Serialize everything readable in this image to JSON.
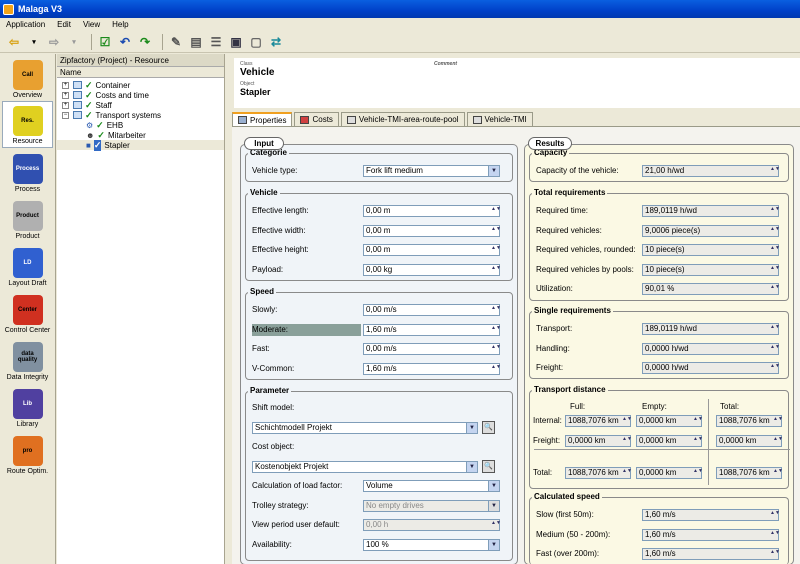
{
  "app": {
    "title": "Malaga V3"
  },
  "menu": [
    "Application",
    "Edit",
    "View",
    "Help"
  ],
  "nav": [
    {
      "label": "Overview",
      "icon": "overview-icon",
      "color": "#e8a030",
      "glyph": "Call"
    },
    {
      "label": "Resource",
      "icon": "resource-icon",
      "color": "#e0d020",
      "glyph": "Res."
    },
    {
      "label": "Process",
      "icon": "process-icon",
      "color": "#3050b0",
      "glyph": "Process"
    },
    {
      "label": "Product",
      "icon": "product-icon",
      "color": "#b0b0b0",
      "glyph": "Product"
    },
    {
      "label": "Layout Draft",
      "icon": "layout-draft-icon",
      "color": "#3060d0",
      "glyph": "LD"
    },
    {
      "label": "Control Center",
      "icon": "control-center-icon",
      "color": "#d03020",
      "glyph": "Center"
    },
    {
      "label": "Data Integrity",
      "icon": "data-integrity-icon",
      "color": "#8090a0",
      "glyph": "data quality"
    },
    {
      "label": "Library",
      "icon": "library-icon",
      "color": "#5040a0",
      "glyph": "Lib"
    },
    {
      "label": "Route Optim.",
      "icon": "route-optim-icon",
      "color": "#e07020",
      "glyph": "pro"
    }
  ],
  "tree": {
    "title": "Zipfactory (Project) - Resource",
    "column": "Name",
    "items": [
      "Container",
      "Costs and time",
      "Staff",
      "Transport systems",
      "EHB",
      "Mitarbeiter",
      "Stapler"
    ]
  },
  "header": {
    "class_label": "Class",
    "class_value": "Vehicle",
    "object_label": "Object",
    "object_value": "Stapler",
    "comment_label": "Comment"
  },
  "tabs": [
    "Properties",
    "Costs",
    "Vehicle-TMI-area-route-pool",
    "Vehicle-TMI"
  ],
  "input": {
    "title": "Input",
    "categorie": {
      "title": "Categorie",
      "vehicle_type_label": "Vehicle type:",
      "vehicle_type": "Fork lift medium"
    },
    "vehicle": {
      "title": "Vehicle",
      "rows": [
        [
          "Effective length:",
          "0,00 m"
        ],
        [
          "Effective width:",
          "0,00 m"
        ],
        [
          "Effective height:",
          "0,00 m"
        ],
        [
          "Payload:",
          "0,00 kg"
        ]
      ]
    },
    "speed": {
      "title": "Speed",
      "rows": [
        [
          "Slowly:",
          "0,00 m/s"
        ],
        [
          "Moderate:",
          "1,60 m/s"
        ],
        [
          "Fast:",
          "0,00 m/s"
        ],
        [
          "V-Common:",
          "1,60 m/s"
        ]
      ]
    },
    "parameter": {
      "title": "Parameter",
      "shift_label": "Shift model:",
      "shift_value": "Schichtmodell Projekt",
      "cost_label": "Cost object:",
      "cost_value": "Kostenobjekt Projekt",
      "load_label": "Calculation of load factor:",
      "load_value": "Volume",
      "trolley_label": "Trolley strategy:",
      "trolley_value": "No empty drives",
      "view_label": "View period user default:",
      "view_value": "0,00 h",
      "avail_label": "Availability:",
      "avail_value": "100 %"
    }
  },
  "results": {
    "title": "Results",
    "capacity": {
      "title": "Capacity",
      "rows": [
        [
          "Capacity of the vehicle:",
          "21,00 h/wd"
        ]
      ]
    },
    "total": {
      "title": "Total requirements",
      "rows": [
        [
          "Required time:",
          "189,0119 h/wd"
        ],
        [
          "Required vehicles:",
          "9,0006 piece(s)"
        ],
        [
          "Required vehicles, rounded:",
          "10 piece(s)"
        ],
        [
          "Required vehicles by pools:",
          "10 piece(s)"
        ],
        [
          "Utilization:",
          "90,01 %"
        ]
      ]
    },
    "single": {
      "title": "Single requirements",
      "rows": [
        [
          "Transport:",
          "189,0119 h/wd"
        ],
        [
          "Handling:",
          "0,0000 h/wd"
        ],
        [
          "Freight:",
          "0,0000 h/wd"
        ]
      ]
    },
    "distance": {
      "title": "Transport distance",
      "col_full": "Full:",
      "col_empty": "Empty:",
      "col_total": "Total:",
      "rows": [
        {
          "label": "Internal:",
          "full": "1088,7076 km",
          "empty": "0,0000 km",
          "total": "1088,7076 km"
        },
        {
          "label": "Freight:",
          "full": "0,0000 km",
          "empty": "0,0000 km",
          "total": "0,0000 km"
        },
        {
          "label": "Total:",
          "full": "1088,7076 km",
          "empty": "0,0000 km",
          "total": "1088,7076 km"
        }
      ]
    },
    "calc_speed": {
      "title": "Calculated speed",
      "rows": [
        [
          "Slow (first 50m):",
          "1,60 m/s"
        ],
        [
          "Medium (50 - 200m):",
          "1,60 m/s"
        ],
        [
          "Fast (over 200m):",
          "1,60 m/s"
        ]
      ]
    }
  }
}
